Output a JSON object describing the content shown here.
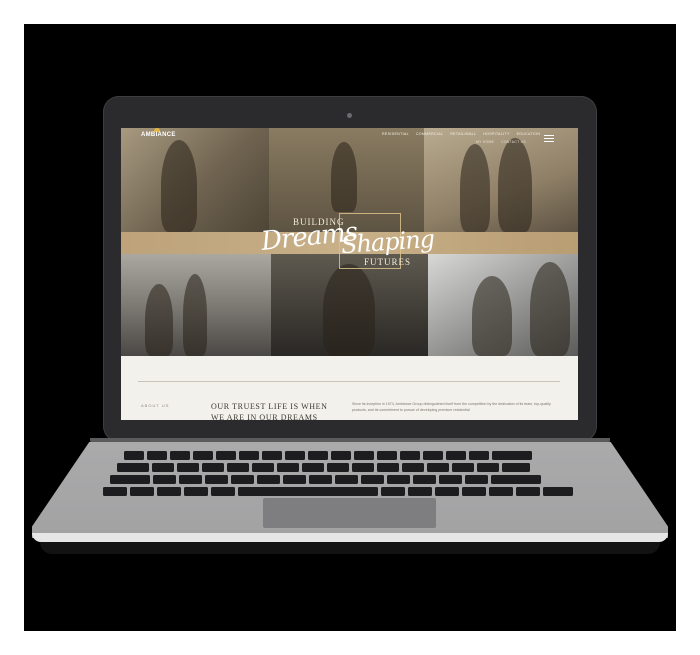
{
  "site": {
    "brand": "AMBIANCE",
    "nav": {
      "items": [
        "RESIDENTIAL",
        "COMMERCIAL",
        "RETAIL/MALL",
        "HOSPITALITY",
        "EDUCATION"
      ],
      "sub_items": [
        "MY HOME",
        "CONTACT US"
      ]
    },
    "hero": {
      "line_top": "BUILDING",
      "script_1": "Dreams",
      "script_2": "Shaping",
      "line_bottom": "FUTURES"
    },
    "intro": {
      "section_label": "ABOUT US",
      "headline": "OUR TRUEST LIFE IS WHEN WE ARE IN OUR DREAMS",
      "body": "Since its inception in 1974, Ambiance Group distinguished itself from the competition by the dedication of its team, top-quality products, and its commitment to pursue of developing premium residential"
    }
  },
  "colors": {
    "accent_gold": "#c8b088",
    "screen_bg": "#f3f1ec",
    "device_dark": "#2b2b2d",
    "device_silver": "#a7a7a8"
  }
}
